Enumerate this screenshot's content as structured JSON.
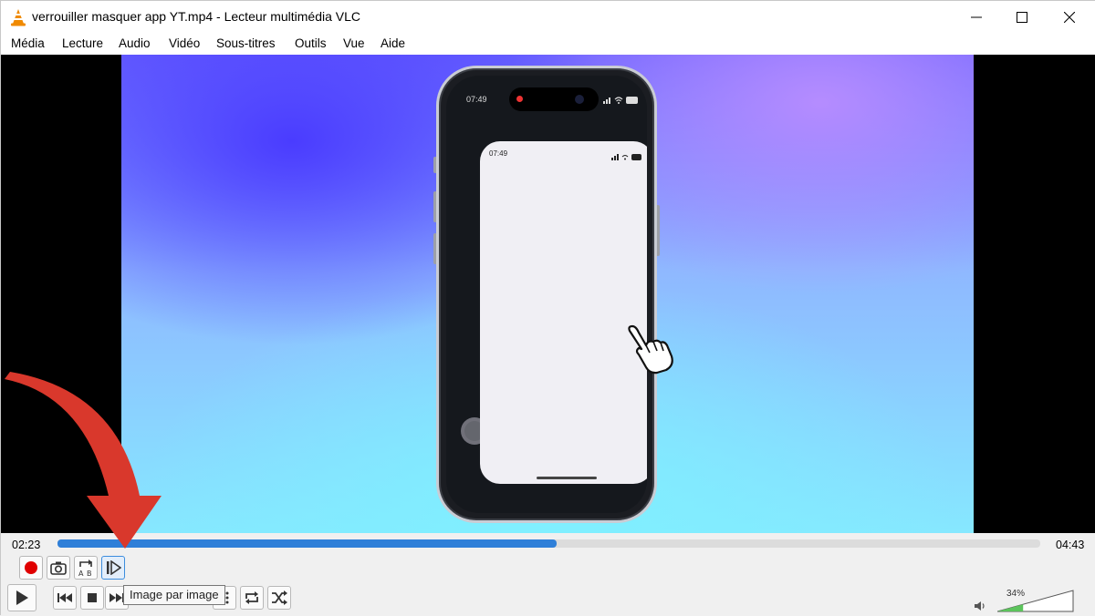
{
  "window": {
    "title": "verrouiller masquer app YT.mp4 - Lecteur multimédia VLC"
  },
  "menu": [
    "Média",
    "Lecture",
    "Audio",
    "Vidéo",
    "Sous-titres",
    "Outils",
    "Vue",
    "Aide"
  ],
  "phone": {
    "status_time": "07:49",
    "card_time": "07:49",
    "battery_text": "76"
  },
  "player": {
    "current_time": "02:23",
    "total_time": "04:43",
    "progress_fraction": 0.508,
    "tooltip": "Image par image",
    "volume_label": "34%",
    "volume_fraction": 0.34
  },
  "icons": {
    "record": "record-icon",
    "snapshot": "camera-icon",
    "loop_ab": "ab-loop-icon",
    "frame_step": "frame-step-icon",
    "play": "play-icon",
    "prev": "previous-icon",
    "stop": "stop-icon",
    "next": "next-icon",
    "loop": "loop-icon",
    "shuffle": "shuffle-icon",
    "volume": "speaker-icon"
  },
  "colors": {
    "seek_fill": "#2f7fd8",
    "arrow": "#d9382c",
    "record": "#e00000",
    "volume_fill": "#5cc45c"
  }
}
